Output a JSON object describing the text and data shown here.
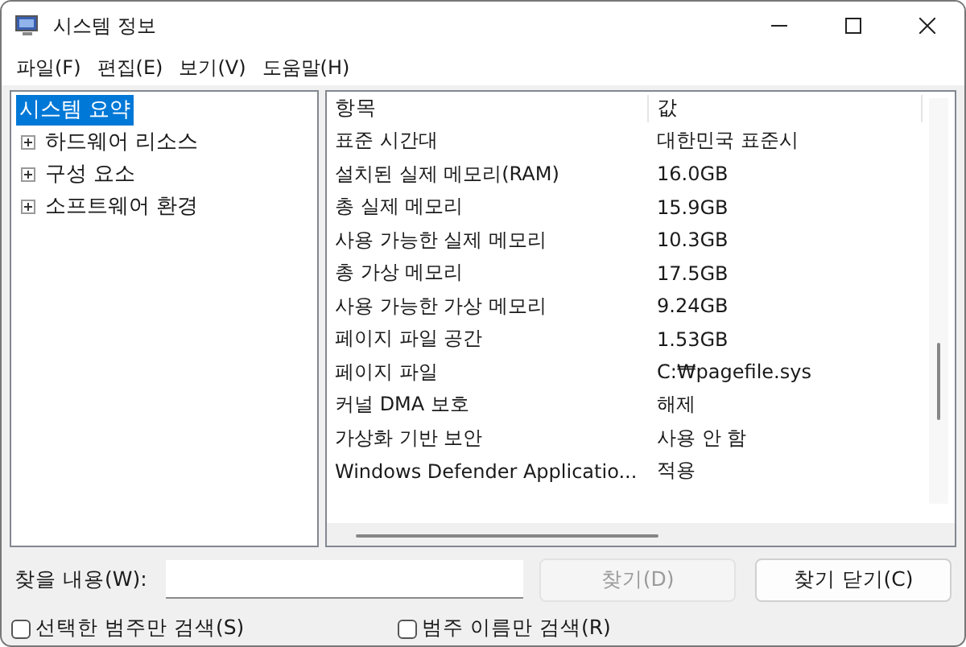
{
  "window": {
    "title": "시스템 정보"
  },
  "menu": [
    "파일(F)",
    "편집(E)",
    "보기(V)",
    "도움말(H)"
  ],
  "tree": [
    {
      "label": "시스템 요약",
      "selected": true,
      "children": [
        {
          "label": "하드웨어 리소스",
          "selected": false,
          "expanded": false
        },
        {
          "label": "구성 요소",
          "selected": false,
          "expanded": false
        },
        {
          "label": "소프트웨어 환경",
          "selected": false,
          "expanded": false
        }
      ]
    }
  ],
  "table": {
    "columns": [
      "항목",
      "값"
    ],
    "rows": [
      [
        "표준 시간대",
        "대한민국 표준시"
      ],
      [
        "설치된 실제 메모리(RAM)",
        "16.0GB"
      ],
      [
        "총 실제 메모리",
        "15.9GB"
      ],
      [
        "사용 가능한 실제 메모리",
        "10.3GB"
      ],
      [
        "총 가상 메모리",
        "17.5GB"
      ],
      [
        "사용 가능한 가상 메모리",
        "9.24GB"
      ],
      [
        "페이지 파일 공간",
        "1.53GB"
      ],
      [
        "페이지 파일",
        "C:₩pagefile.sys"
      ],
      [
        "커널 DMA 보호",
        "해제"
      ],
      [
        "가상화 기반 보안",
        "사용 안 함"
      ],
      [
        "Windows Defender Applicatio...",
        "적용"
      ]
    ]
  },
  "find": {
    "label": "찾을 내용(W):",
    "find_button": {
      "label": "찾기(D)",
      "disabled": true
    },
    "close_button": {
      "label": "찾기 닫기(C)",
      "disabled": false
    }
  },
  "options": [
    {
      "label": "선택한 범주만 검색(S)",
      "checked": false
    },
    {
      "label": "범주 이름만 검색(R)",
      "checked": false
    }
  ]
}
